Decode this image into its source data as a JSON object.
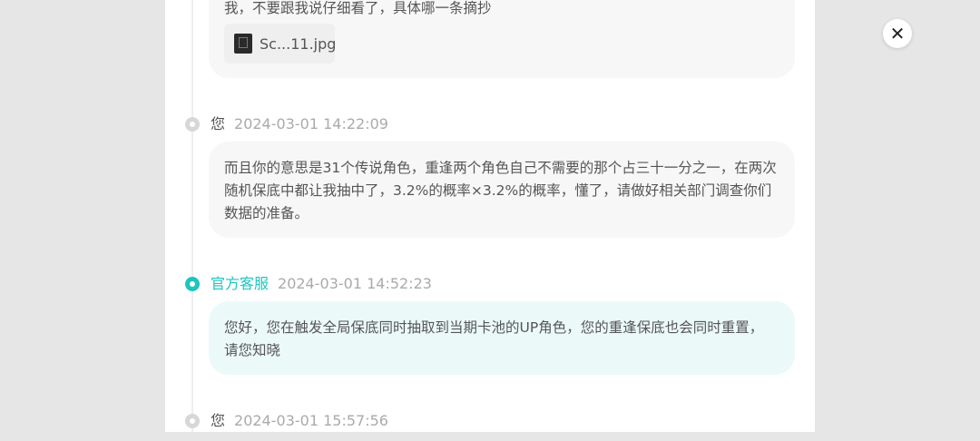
{
  "close_button": {
    "glyph": "✕",
    "icon": "close-icon"
  },
  "messages": [
    {
      "text": "我，不要跟我说仔细看了，具体哪一条摘抄",
      "attachment": {
        "name": "Sc...11.jpg",
        "icon": "image-thumbnail-icon"
      }
    },
    {
      "author": "您",
      "time": "2024-03-01 14:22:09",
      "text": "而且你的意思是31个传说角色，重逢两个角色自己不需要的那个占三十一分之一，在两次随机保底中都让我抽中了，3.2%的概率×3.2%的概率，懂了，请做好相关部门调查你们数据的准备。"
    },
    {
      "author": "官方客服",
      "time": "2024-03-01 14:52:23",
      "text": "您好，您在触发全局保底同时抽取到当期卡池的UP角色，您的重逢保底也会同时重置，请您知晓"
    },
    {
      "author": "您",
      "time": "2024-03-01 15:57:56"
    }
  ],
  "colors": {
    "accent": "#1ec5c0",
    "user_bubble": "#f7f7f7",
    "official_bubble": "#ecf9f9",
    "backdrop": "#e6e6e6"
  }
}
